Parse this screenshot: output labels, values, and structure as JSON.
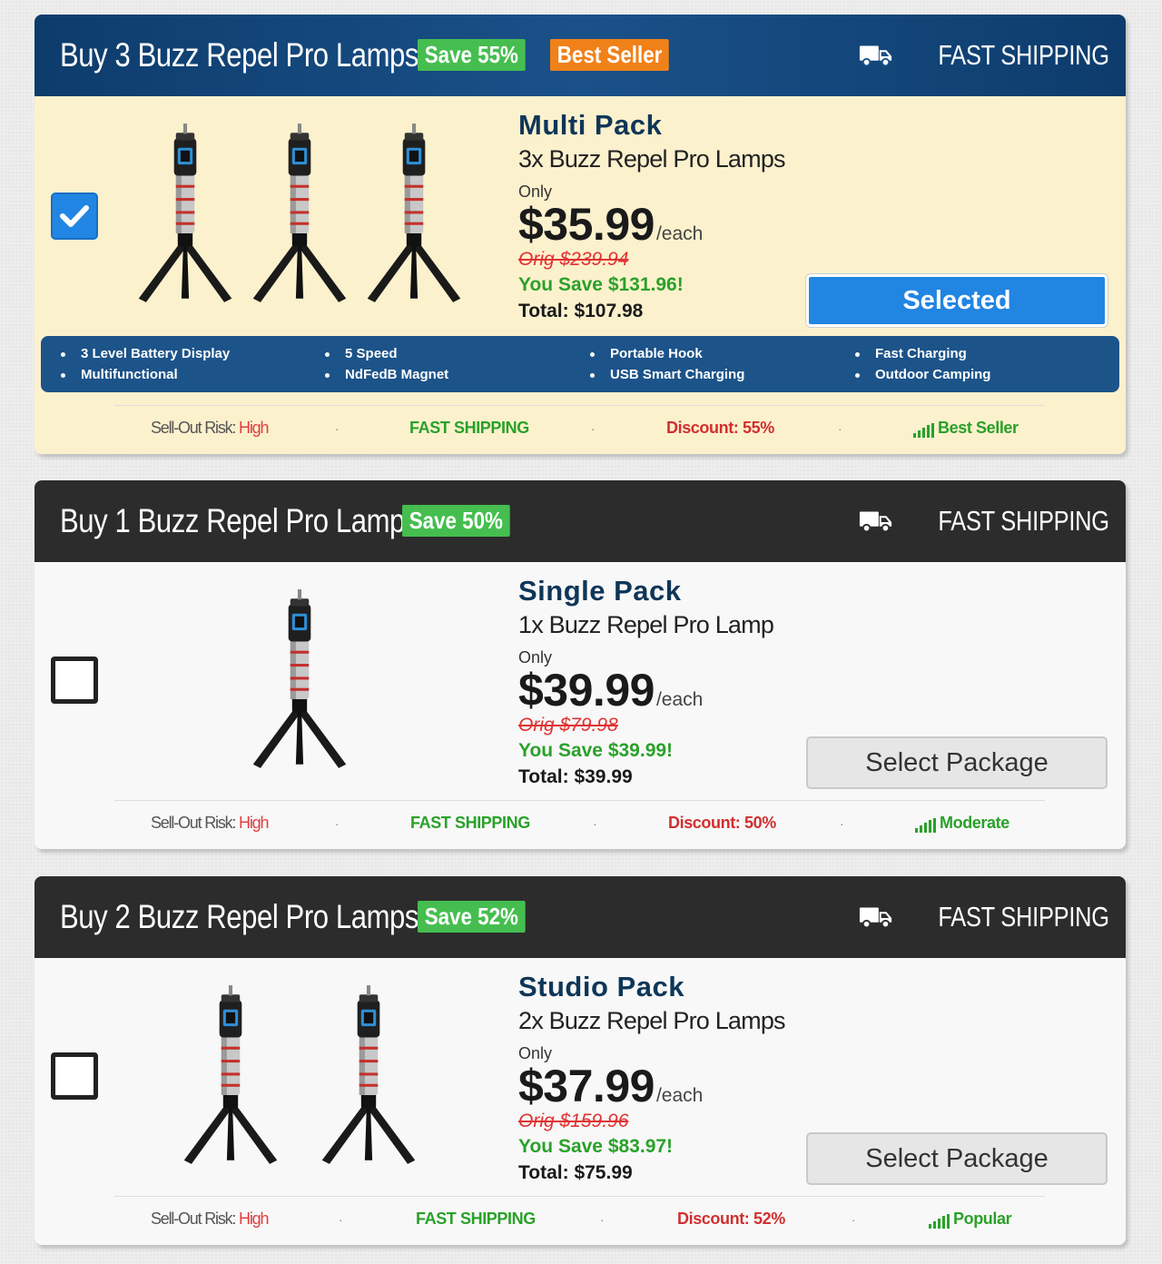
{
  "packages": [
    {
      "header_title": "Buy 3 Buzz Repel Pro Lamps",
      "badges": [
        "Save 55%",
        "Best Seller"
      ],
      "shipping": "FAST SHIPPING",
      "selected": true,
      "pack_name": "Multi Pack",
      "pack_desc": "3x Buzz Repel Pro Lamps",
      "only": "Only",
      "price": "$35.99",
      "each": "/each",
      "orig": "Orig $239.94",
      "save": "You Save $131.96!",
      "total_label": "Total:",
      "total_value": "$107.98",
      "button": "Selected",
      "features": [
        [
          "3 Level Battery Display",
          "Multifunctional"
        ],
        [
          "5 Speed",
          "NdFedB Magnet"
        ],
        [
          "Portable Hook",
          "USB Smart Charging"
        ],
        [
          "Fast Charging",
          "Outdoor Camping"
        ]
      ],
      "stats": {
        "risk_label": "Sell-Out Risk:",
        "risk_value": "High",
        "shipping": "FAST SHIPPING",
        "discount": "Discount: 55%",
        "popularity": "Best Seller"
      }
    },
    {
      "header_title": "Buy 1 Buzz Repel Pro Lamp",
      "badges": [
        "Save 50%"
      ],
      "shipping": "FAST SHIPPING",
      "selected": false,
      "pack_name": "Single Pack",
      "pack_desc": "1x Buzz Repel Pro Lamp",
      "only": "Only",
      "price": "$39.99",
      "each": "/each",
      "orig": "Orig $79.98",
      "save": "You Save $39.99!",
      "total_label": "Total:",
      "total_value": "$39.99",
      "button": "Select Package",
      "stats": {
        "risk_label": "Sell-Out Risk:",
        "risk_value": "High",
        "shipping": "FAST SHIPPING",
        "discount": "Discount: 50%",
        "popularity": "Moderate"
      }
    },
    {
      "header_title": "Buy 2 Buzz Repel Pro Lamps",
      "badges": [
        "Save 52%"
      ],
      "shipping": "FAST SHIPPING",
      "selected": false,
      "pack_name": "Studio Pack",
      "pack_desc": "2x Buzz Repel Pro Lamps",
      "only": "Only",
      "price": "$37.99",
      "each": "/each",
      "orig": "Orig $159.96",
      "save": "You Save $83.97!",
      "total_label": "Total:",
      "total_value": "$75.99",
      "button": "Select Package",
      "stats": {
        "risk_label": "Sell-Out Risk:",
        "risk_value": "High",
        "shipping": "FAST SHIPPING",
        "discount": "Discount: 52%",
        "popularity": "Popular"
      }
    }
  ],
  "icons": {
    "truck": "truck-icon",
    "lamp": "lamp-tripod-icon",
    "check": "check-icon",
    "signal": "signal-bars-icon"
  },
  "colors": {
    "header_blue": "#1a5189",
    "header_dark": "#2c2c2c",
    "badge_green": "#45be4f",
    "badge_orange": "#f08119",
    "selected_bg": "#fcf1cd",
    "button_blue": "#2185e2",
    "save_green": "#2aa12a",
    "orig_red": "#e03333"
  }
}
